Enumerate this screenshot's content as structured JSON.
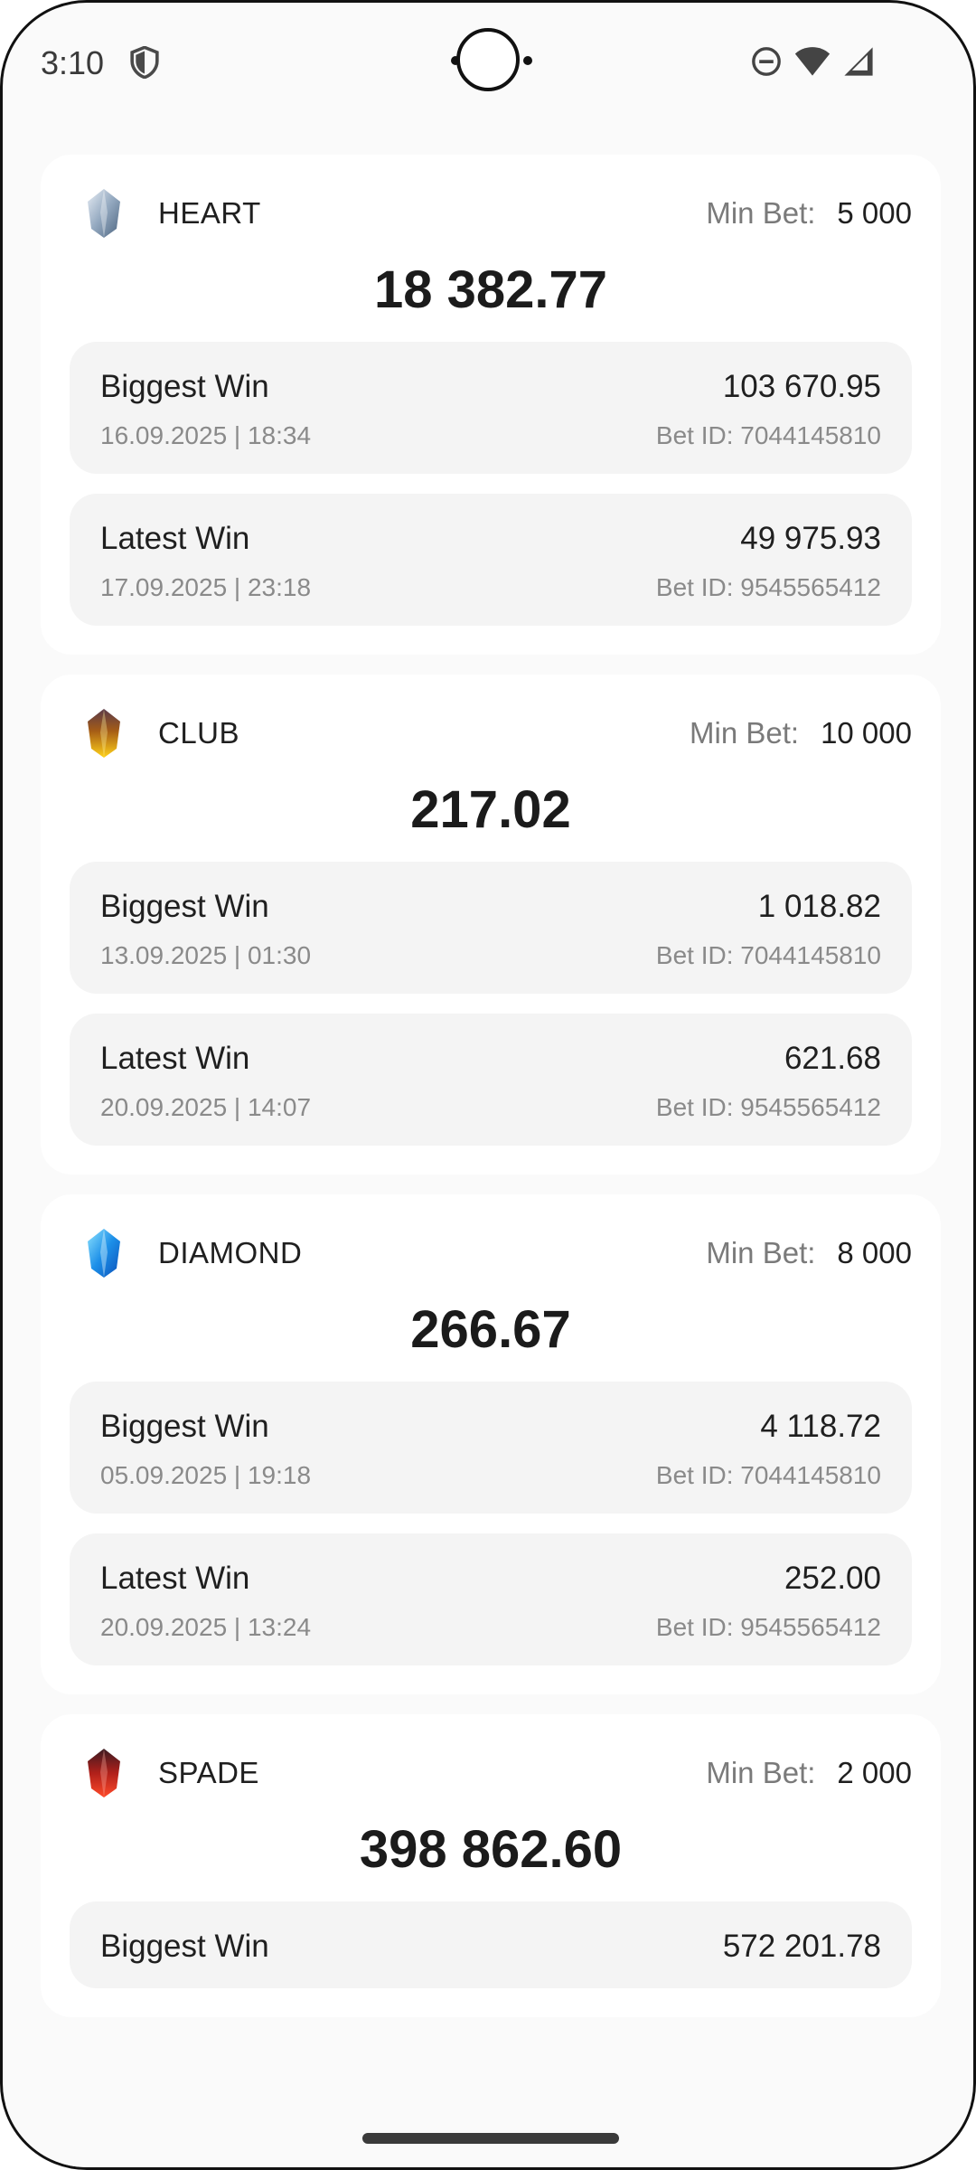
{
  "status": {
    "time": "3:10",
    "icons": [
      "shield-icon",
      "do-not-disturb-icon",
      "wifi-icon",
      "signal-icon"
    ]
  },
  "jackpots": [
    {
      "name": "HEART",
      "icon": "heart-gem-icon",
      "gem_color": "#9fb3c8",
      "min_bet_label": "Min Bet:",
      "min_bet": "5 000",
      "amount": "18 382.77",
      "biggest": {
        "label": "Biggest Win",
        "amount": "103 670.95",
        "date": "16.09.2025 | 18:34",
        "bet_id": "Bet ID: 7044145810"
      },
      "latest": {
        "label": "Latest Win",
        "amount": "49 975.93",
        "date": "17.09.2025 | 23:18",
        "bet_id": "Bet ID: 9545565412"
      }
    },
    {
      "name": "CLUB",
      "icon": "club-gem-icon",
      "gem_color": "#d9a21b",
      "min_bet_label": "Min Bet:",
      "min_bet": "10 000",
      "amount": "217.02",
      "biggest": {
        "label": "Biggest Win",
        "amount": "1 018.82",
        "date": "13.09.2025 | 01:30",
        "bet_id": "Bet ID: 7044145810"
      },
      "latest": {
        "label": "Latest Win",
        "amount": "621.68",
        "date": "20.09.2025 | 14:07",
        "bet_id": "Bet ID: 9545565412"
      }
    },
    {
      "name": "DIAMOND",
      "icon": "diamond-gem-icon",
      "gem_color": "#1fa0f0",
      "min_bet_label": "Min Bet:",
      "min_bet": "8 000",
      "amount": "266.67",
      "biggest": {
        "label": "Biggest Win",
        "amount": "4 118.72",
        "date": "05.09.2025 | 19:18",
        "bet_id": "Bet ID: 7044145810"
      },
      "latest": {
        "label": "Latest Win",
        "amount": "252.00",
        "date": "20.09.2025 | 13:24",
        "bet_id": "Bet ID: 9545565412"
      }
    },
    {
      "name": "SPADE",
      "icon": "spade-gem-icon",
      "gem_color": "#d4281c",
      "min_bet_label": "Min Bet:",
      "min_bet": "2 000",
      "amount": "398 862.60",
      "biggest": {
        "label": "Biggest Win",
        "amount": "572 201.78"
      }
    }
  ]
}
